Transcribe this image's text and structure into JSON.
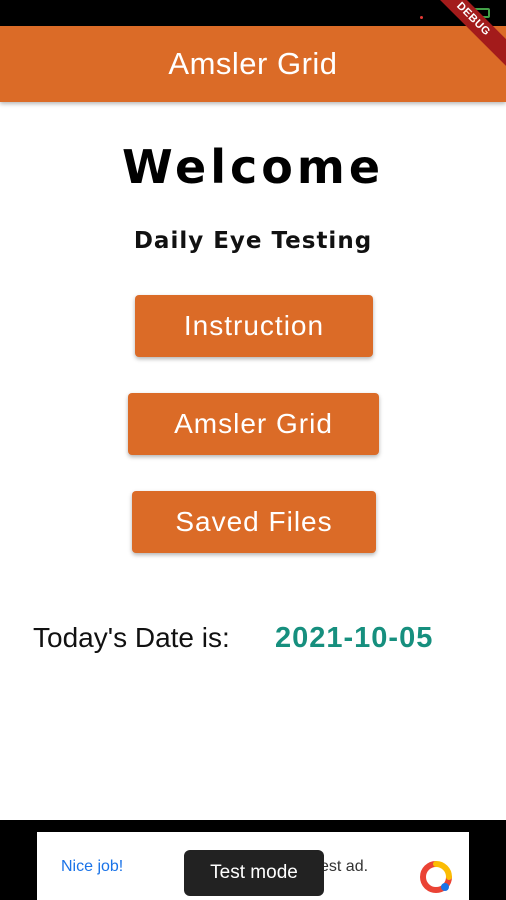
{
  "app_bar": {
    "title": "Amsler Grid",
    "debug_label": "DEBUG"
  },
  "main": {
    "welcome": "Welcome",
    "subtitle": "Daily Eye Testing",
    "buttons": {
      "instruction": "Instruction",
      "amsler_grid": "Amsler Grid",
      "saved_files": "Saved Files"
    },
    "date_label": "Today's Date is:",
    "date_value": "2021-10-05"
  },
  "ad": {
    "left_text": "Nice job!",
    "right_text": "est ad.",
    "toast": "Test mode",
    "logo_icon": "ad-logo-icon"
  },
  "colors": {
    "primary": "#db6b27",
    "date": "#168f7e",
    "link": "#1a73e8"
  }
}
